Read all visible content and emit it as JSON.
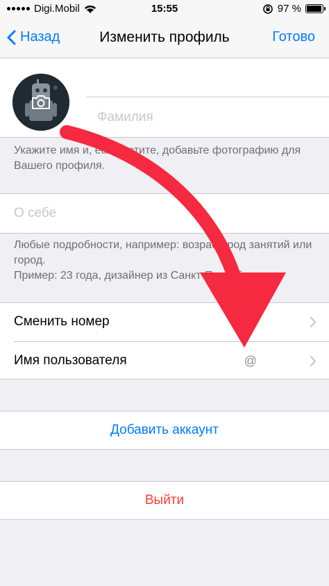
{
  "status_bar": {
    "carrier": "Digi.Mobil",
    "time": "15:55",
    "battery_percent": "97 %",
    "battery_level": 0.97
  },
  "nav": {
    "back_label": "Назад",
    "title": "Изменить профиль",
    "done_label": "Готово"
  },
  "profile": {
    "first_name_value": "",
    "first_name_placeholder": "",
    "last_name_value": "",
    "last_name_placeholder": "Фамилия",
    "hint": "Укажите имя и, если хотите, добавьте фотографию для Вашего профиля."
  },
  "about": {
    "value": "",
    "placeholder": "О себе",
    "hint_line1": "Любые подробности, например: возраст, род занятий или город.",
    "hint_line2": "Пример: 23 года, дизайнер из Санкт-Петербурга."
  },
  "account_rows": [
    {
      "label": "Сменить номер",
      "value": ""
    },
    {
      "label": "Имя пользователя",
      "value": "@"
    }
  ],
  "actions": {
    "add_account": "Добавить аккаунт",
    "logout": "Выйти"
  },
  "colors": {
    "accent": "#007aff",
    "destructive": "#ff3b30",
    "annotation_arrow": "#f5293f"
  },
  "icons": {
    "avatar_overlay": "camera-icon",
    "back": "chevron-left-icon",
    "row_disclosure": "chevron-right-icon"
  }
}
